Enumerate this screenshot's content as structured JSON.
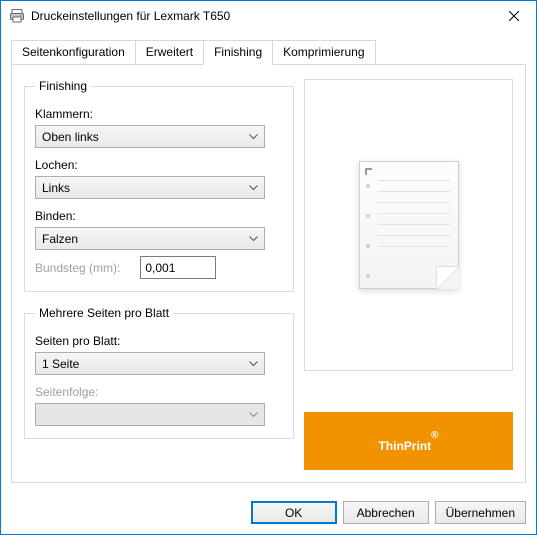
{
  "window": {
    "title": "Druckeinstellungen für Lexmark T650"
  },
  "tabs": {
    "page_config": "Seitenkonfiguration",
    "advanced": "Erweitert",
    "finishing": "Finishing",
    "compression": "Komprimierung"
  },
  "finishing": {
    "legend": "Finishing",
    "staple_label": "Klammern:",
    "staple_value": "Oben links",
    "punch_label": "Lochen:",
    "punch_value": "Links",
    "bind_label": "Binden:",
    "bind_value": "Falzen",
    "gutter_label": "Bundsteg (mm):",
    "gutter_value": "0,001"
  },
  "nup": {
    "legend": "Mehrere Seiten pro Blatt",
    "pps_label": "Seiten pro Blatt:",
    "pps_value": "1 Seite",
    "order_label": "Seitenfolge:",
    "order_value": ""
  },
  "brand": "ThinPrint",
  "buttons": {
    "ok": "OK",
    "cancel": "Abbrechen",
    "apply": "Übernehmen"
  }
}
